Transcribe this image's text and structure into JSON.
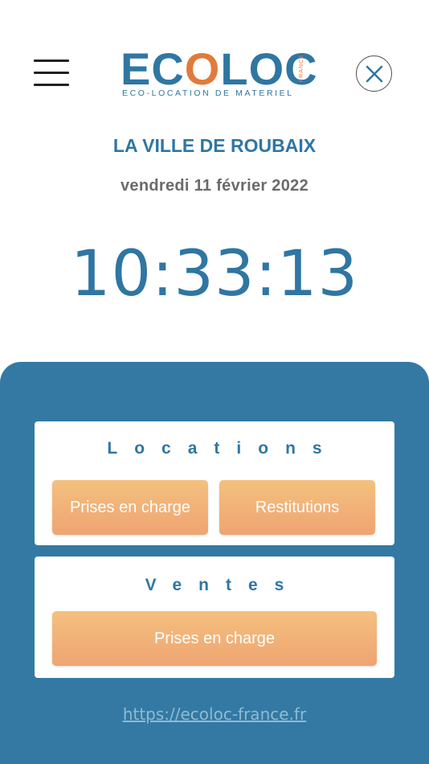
{
  "header": {
    "logo": {
      "wordmark_start": "EC",
      "wordmark_accent": "O",
      "wordmark_end": "LOC",
      "country": "FRANCE",
      "tagline": "ECO-LOCATION DE MATERIEL"
    },
    "menu_icon": "hamburger-icon",
    "close_icon": "close-icon"
  },
  "info": {
    "city": "LA VILLE DE ROUBAIX",
    "date": "vendredi 11 février 2022",
    "time": "10:33:13"
  },
  "locations": {
    "title": "Locations",
    "pickup_label": "Prises en charge",
    "returns_label": "Restitutions"
  },
  "ventes": {
    "title": "Ventes",
    "pickup_label": "Prises en charge"
  },
  "footer": {
    "link": "https://ecoloc-france.fr"
  },
  "colors": {
    "brand_blue": "#2f76a3",
    "brand_orange": "#e07b3b",
    "panel_blue": "#3379a3",
    "button_orange": "#f0ad74"
  }
}
